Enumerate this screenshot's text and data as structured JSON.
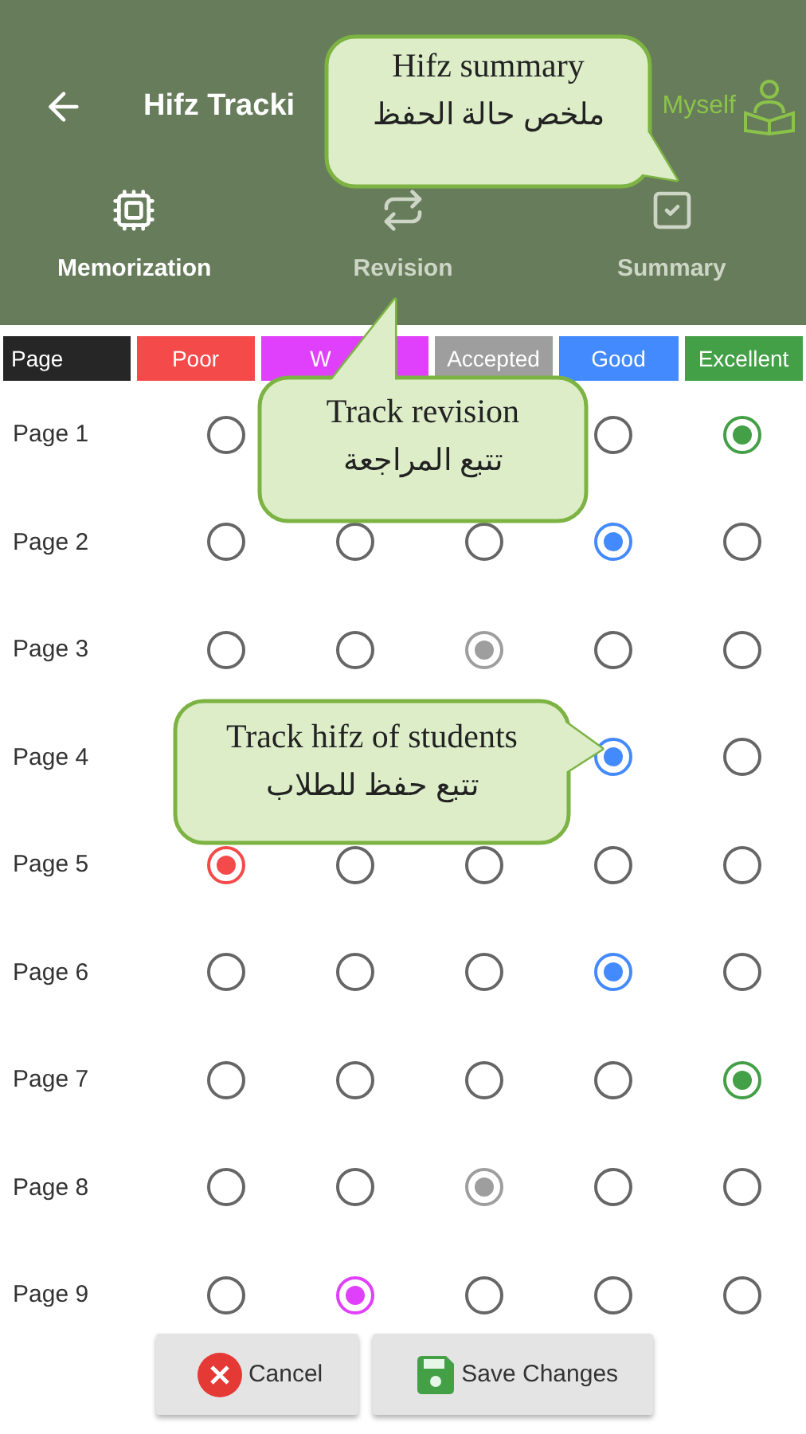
{
  "header": {
    "title": "Hifz Tracki",
    "account": "Myself"
  },
  "tabs": [
    {
      "label": "Memorization",
      "selected": true
    },
    {
      "label": "Revision",
      "selected": false
    },
    {
      "label": "Summary",
      "selected": false
    }
  ],
  "columns": [
    {
      "label": "Page",
      "color": "#262626"
    },
    {
      "label": "Poor",
      "color": "#f44a4a"
    },
    {
      "label": "W",
      "color": "#e040fb"
    },
    {
      "label": "Accepted",
      "color": "#9e9e9e"
    },
    {
      "label": "Good",
      "color": "#448aff"
    },
    {
      "label": "Excellent",
      "color": "#43a047"
    }
  ],
  "rows": [
    {
      "page": "Page 1",
      "poor": {
        "selected": false
      },
      "good": {
        "selected": false
      },
      "excellent": {
        "selected": true
      }
    },
    {
      "page": "Page 2",
      "poor": {
        "selected": false
      },
      "column_3": {
        "selected": false
      },
      "accepted": {
        "selected": false
      },
      "good": {
        "selected": true
      },
      "excellent": {
        "selected": false
      }
    },
    {
      "page": "Page 3",
      "poor": {
        "selected": false
      },
      "column_3": {
        "selected": false
      },
      "accepted": {
        "selected": true
      },
      "good": {
        "selected": false
      },
      "excellent": {
        "selected": false
      }
    },
    {
      "page": "Page 4",
      "good": {
        "selected": true
      },
      "excellent": {
        "selected": false
      }
    },
    {
      "page": "Page 5",
      "poor": {
        "selected": true
      },
      "column_3": {
        "selected": false
      },
      "accepted": {
        "selected": false
      },
      "good": {
        "selected": false
      },
      "excellent": {
        "selected": false
      }
    },
    {
      "page": "Page 6",
      "poor": {
        "selected": false
      },
      "column_3": {
        "selected": false
      },
      "accepted": {
        "selected": false
      },
      "good": {
        "selected": true
      },
      "excellent": {
        "selected": false
      }
    },
    {
      "page": "Page 7",
      "poor": {
        "selected": false
      },
      "column_3": {
        "selected": false
      },
      "accepted": {
        "selected": false
      },
      "good": {
        "selected": false
      },
      "excellent": {
        "selected": true
      }
    },
    {
      "page": "Page 8",
      "poor": {
        "selected": false
      },
      "column_3": {
        "selected": false
      },
      "accepted": {
        "selected": true
      },
      "good": {
        "selected": false
      },
      "excellent": {
        "selected": false
      }
    },
    {
      "page": "Page 9",
      "poor": {
        "selected": false
      },
      "column_3": {
        "selected": true
      },
      "accepted": {
        "selected": false
      },
      "good": {
        "selected": false
      },
      "excellent": {
        "selected": false
      }
    }
  ],
  "buttons": [
    {
      "label": "Cancel",
      "kind": "cancel"
    },
    {
      "label": "Save Changes",
      "kind": "save"
    }
  ],
  "callouts": [
    {
      "kind": "down-right",
      "english": "Hifz summary",
      "arabic": "ملخص حالة الحفظ"
    },
    {
      "kind": "up",
      "english": "Track revision",
      "arabic": "تتبع المراجعة"
    },
    {
      "kind": "right",
      "english": "Track hifz of students",
      "arabic": "تتبع حفظ للطلاب"
    }
  ]
}
